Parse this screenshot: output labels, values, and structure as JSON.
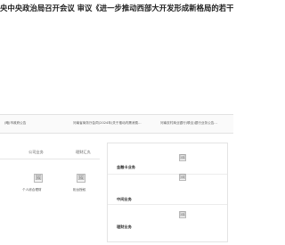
{
  "headline": {
    "text": "央中央政治局召开会议 审议《进一步推动西部大开发形成新格局的若干政策措施》"
  },
  "notices": [
    {
      "text": "(略)市政府公告"
    },
    {
      "text": "河南省商务厅会同(2024年)关于推动内需消费…"
    },
    {
      "text": "河南农村商业银行(联合)银行业务公告…"
    }
  ],
  "tabs": {
    "company": {
      "label": "公司业务"
    },
    "wealth": {
      "label": "理财汇丸"
    }
  },
  "tiles": [
    {
      "label": "个人综合理财"
    },
    {
      "label": "柜台授权"
    }
  ],
  "right_rows": [
    {
      "label": "金融卡业务"
    },
    {
      "label": "中间业务"
    },
    {
      "label": "理财业务"
    }
  ],
  "icons": {
    "placeholder_glyph": "🖼"
  }
}
